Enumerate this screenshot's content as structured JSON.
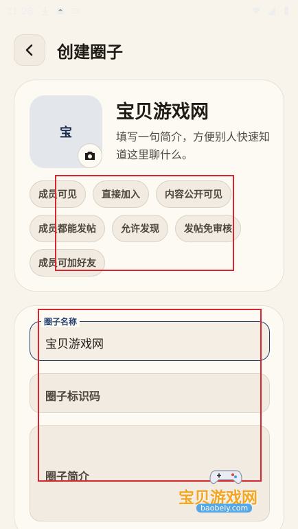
{
  "status_bar": {
    "time": "11:28"
  },
  "header": {
    "title": "创建圈子"
  },
  "profile": {
    "avatar_letter": "宝",
    "name": "宝贝游戏网",
    "description": "填写一句简介，方便别人快速知道这里聊什么。"
  },
  "tags": [
    "成员可见",
    "直接加入",
    "内容公开可见",
    "成员都能发帖",
    "允许发现",
    "发帖免审核",
    "成员可加好友"
  ],
  "form": {
    "name_legend": "圈子名称",
    "name_value": "宝贝游戏网",
    "id_label": "圈子标识码",
    "intro_label": "圈子简介"
  },
  "watermark": {
    "text": "宝贝游戏网",
    "url": "baobeiy.com"
  },
  "colors": {
    "background": "#f8f4ec",
    "accent": "#233e6b",
    "highlight": "#d9252d"
  }
}
